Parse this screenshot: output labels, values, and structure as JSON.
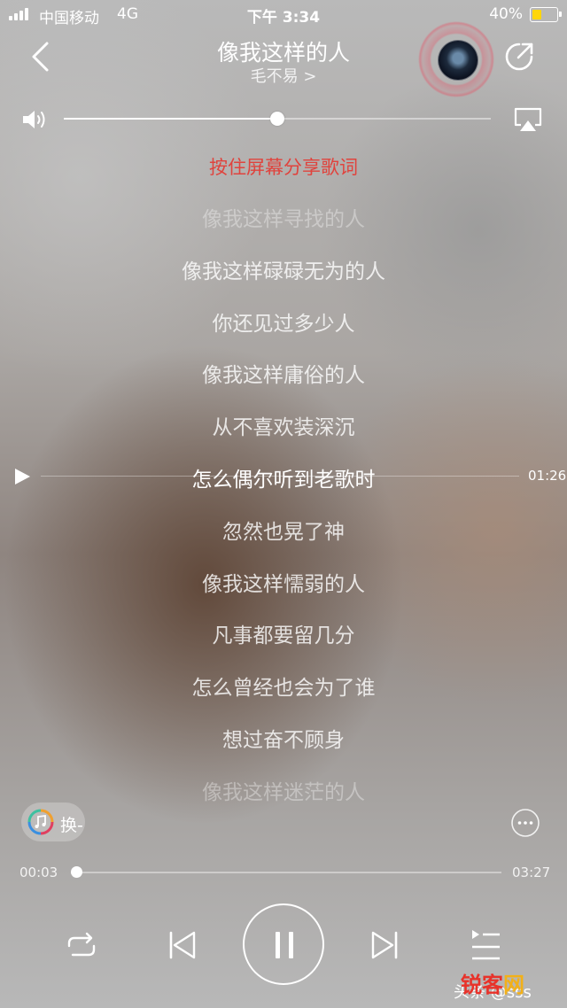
{
  "status_bar": {
    "carrier": "中国移动",
    "network": "4G",
    "time": "下午 3:34",
    "battery_percent": "40%",
    "battery_level": 0.4,
    "battery_color": "#ffd60a"
  },
  "header": {
    "song_title": "像我这样的人",
    "artist": "毛不易 >",
    "back_icon": "chevron-left-icon",
    "share_icon": "share-icon"
  },
  "volume": {
    "level": 0.5
  },
  "lyrics": {
    "hint": "按住屏幕分享歌词",
    "hint_color": "#e0433d",
    "lines": [
      "像我这样寻找的人",
      "像我这样碌碌无为的人",
      "你还见过多少人",
      "像我这样庸俗的人",
      "从不喜欢装深沉",
      "怎么偶尔听到老歌时",
      "忽然也晃了神",
      "像我这样懦弱的人",
      "凡事都要留几分",
      "怎么曾经也会为了谁",
      "想过奋不顾身",
      "像我这样迷茫的人"
    ],
    "current_index": 5,
    "seek_time": "01:26"
  },
  "player": {
    "quality_label": "换-",
    "elapsed": "00:03",
    "duration": "03:27",
    "progress": 0.014
  },
  "watermark": {
    "text": "头条 @sss",
    "logo_a": "锐客",
    "logo_b": "网"
  }
}
